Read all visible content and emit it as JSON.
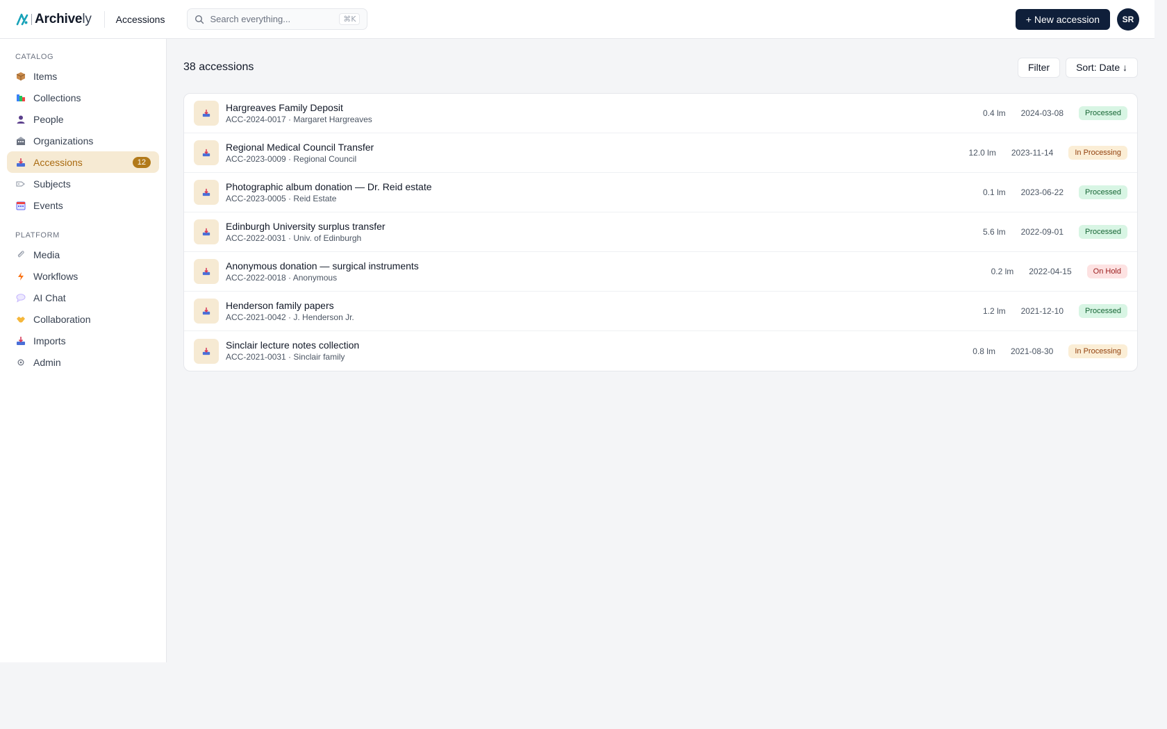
{
  "header": {
    "brand_name": "Archive",
    "brand_suffix": "ly",
    "breadcrumb": "Accessions",
    "search_placeholder": "Search everything...",
    "search_shortcut": "⌘K",
    "new_button": "+ New accession",
    "avatar_initials": "SR"
  },
  "sidebar": {
    "catalog_label": "CATALOG",
    "platform_label": "PLATFORM",
    "catalog_items": [
      {
        "label": "Items",
        "icon": "box-icon"
      },
      {
        "label": "Collections",
        "icon": "books-icon"
      },
      {
        "label": "People",
        "icon": "person-icon"
      },
      {
        "label": "Organizations",
        "icon": "building-icon"
      },
      {
        "label": "Accessions",
        "icon": "inbox-tray-icon",
        "badge": "12",
        "active": true
      },
      {
        "label": "Subjects",
        "icon": "tag-icon"
      },
      {
        "label": "Events",
        "icon": "calendar-icon"
      }
    ],
    "platform_items": [
      {
        "label": "Media",
        "icon": "paperclip-icon"
      },
      {
        "label": "Workflows",
        "icon": "lightning-icon"
      },
      {
        "label": "AI Chat",
        "icon": "speech-bubble-icon"
      },
      {
        "label": "Collaboration",
        "icon": "handshake-icon"
      },
      {
        "label": "Imports",
        "icon": "inbox-tray-icon"
      },
      {
        "label": "Admin",
        "icon": "gear-icon"
      }
    ]
  },
  "main": {
    "count_label": "38 accessions",
    "filter_label": "Filter",
    "sort_label": "Sort: Date ↓",
    "rows": [
      {
        "title": "Hargreaves Family Deposit",
        "subtitle": "ACC-2024-0017 · Margaret Hargreaves",
        "size": "0.4 lm",
        "date": "2024-03-08",
        "status": "Processed",
        "status_type": "processed"
      },
      {
        "title": "Regional Medical Council Transfer",
        "subtitle": "ACC-2023-0009 · Regional Council",
        "size": "12.0 lm",
        "date": "2023-11-14",
        "status": "In Processing",
        "status_type": "inproc"
      },
      {
        "title": "Photographic album donation — Dr. Reid estate",
        "subtitle": "ACC-2023-0005 · Reid Estate",
        "size": "0.1 lm",
        "date": "2023-06-22",
        "status": "Processed",
        "status_type": "processed"
      },
      {
        "title": "Edinburgh University surplus transfer",
        "subtitle": "ACC-2022-0031 · Univ. of Edinburgh",
        "size": "5.6 lm",
        "date": "2022-09-01",
        "status": "Processed",
        "status_type": "processed"
      },
      {
        "title": "Anonymous donation — surgical instruments",
        "subtitle": "ACC-2022-0018 · Anonymous",
        "size": "0.2 lm",
        "date": "2022-04-15",
        "status": "On Hold",
        "status_type": "hold"
      },
      {
        "title": "Henderson family papers",
        "subtitle": "ACC-2021-0042 · J. Henderson Jr.",
        "size": "1.2 lm",
        "date": "2021-12-10",
        "status": "Processed",
        "status_type": "processed"
      },
      {
        "title": "Sinclair lecture notes collection",
        "subtitle": "ACC-2021-0031 · Sinclair family",
        "size": "0.8 lm",
        "date": "2021-08-30",
        "status": "In Processing",
        "status_type": "inproc"
      }
    ]
  },
  "colors": {
    "brand_navy": "#0f1f3a",
    "accent_amber": "#b27a1a",
    "active_bg": "#f6ead3",
    "processed_bg": "#d8f5e4",
    "in_processing_bg": "#fbeed6",
    "on_hold_bg": "#fde2e2"
  }
}
